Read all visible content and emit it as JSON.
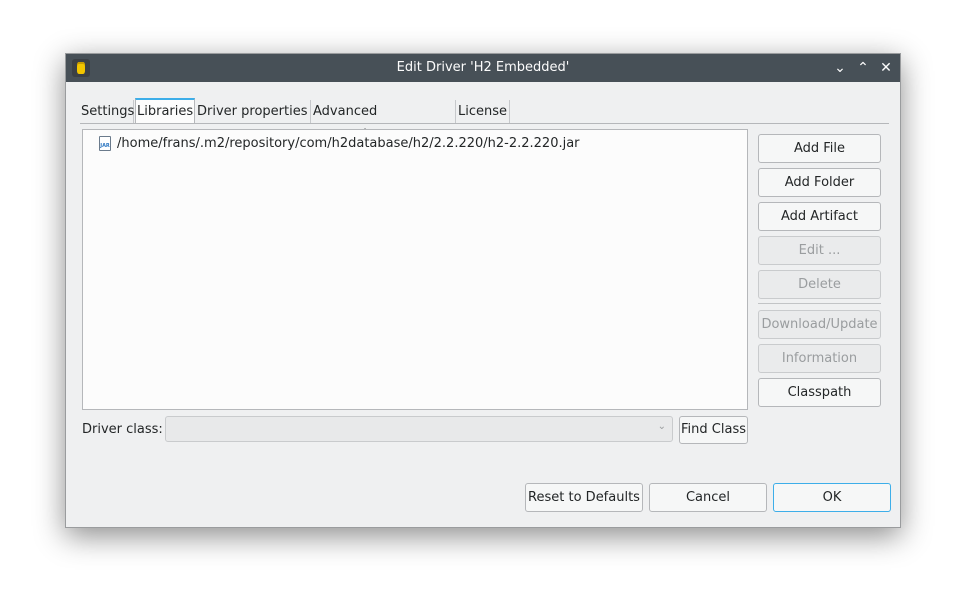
{
  "window": {
    "title": "Edit Driver 'H2 Embedded'",
    "controls": [
      "minimize",
      "maximize",
      "close"
    ]
  },
  "tabs": [
    {
      "label": "Settings",
      "active": false
    },
    {
      "label": "Libraries",
      "active": true
    },
    {
      "label": "Driver properties",
      "active": false
    },
    {
      "label": "Advanced parameters",
      "active": false
    },
    {
      "label": "License",
      "active": false
    }
  ],
  "libraries": [
    {
      "icon": "jar-file-icon",
      "icon_text": "JAR",
      "path": "/home/frans/.m2/repository/com/h2database/h2/2.2.220/h2-2.2.220.jar"
    }
  ],
  "side_buttons": [
    {
      "label": "Add File",
      "enabled": true
    },
    {
      "label": "Add Folder",
      "enabled": true
    },
    {
      "label": "Add Artifact",
      "enabled": true
    },
    {
      "label": "Edit ...",
      "enabled": false
    },
    {
      "label": "Delete",
      "enabled": false
    },
    {
      "label": "Download/Update",
      "enabled": false
    },
    {
      "label": "Information",
      "enabled": false
    },
    {
      "label": "Classpath",
      "enabled": true
    }
  ],
  "driver_class": {
    "label": "Driver class:",
    "value": "",
    "find_button": "Find Class"
  },
  "footer": {
    "reset_label": "Reset to Defaults",
    "cancel_label": "Cancel",
    "ok_label": "OK"
  },
  "colors": {
    "titlebar": "#475057",
    "accent": "#3daee9",
    "window_bg": "#eff0f1"
  }
}
